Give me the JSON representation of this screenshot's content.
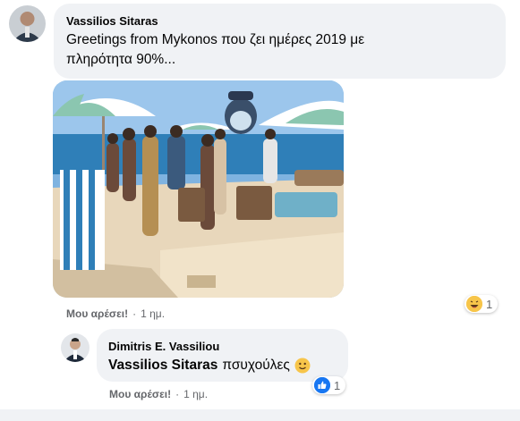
{
  "comment": {
    "author": "Vassilios Sitaras",
    "text_line1": "Greetings from Mykonos που ζει ημέρες 2019 με",
    "text_line2": "πληρότητα 90%...",
    "like_label": "Μου αρέσει!",
    "separator": "·",
    "time": "1 ημ.",
    "reaction_count": "1",
    "reaction_icon": "haha-emoji-icon"
  },
  "reply": {
    "author": "Dimitris E. Vassiliou",
    "mention": "Vassilios Sitaras",
    "text": "πσυχούλες",
    "emoji": "slightly-smiling-face",
    "like_label": "Μου αρέσει!",
    "separator": "·",
    "time": "1 ημ.",
    "reaction_count": "1",
    "reaction_icon": "like-icon"
  },
  "colors": {
    "bubble": "#f0f2f5",
    "meta_text": "#65676b",
    "like_blue": "#1877f2"
  }
}
